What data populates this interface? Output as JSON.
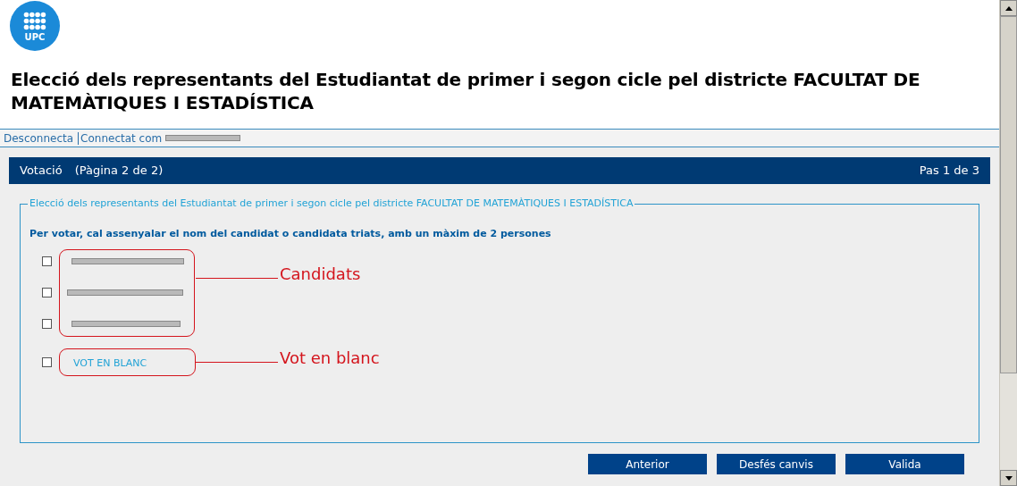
{
  "logo": {
    "text": "UPC"
  },
  "title": "Elecció dels representants del Estudiantat de primer i segon cicle pel districte FACULTAT DE MATEMÀTIQUES I ESTADÍSTICA",
  "user_bar": {
    "logout": "Desconnecta",
    "connected_as": "Connectat com",
    "user_redacted": true
  },
  "header": {
    "title": "Votació",
    "page": "(Pàgina 2 de 2)",
    "step": "Pas 1 de 3"
  },
  "fieldset": {
    "legend": "Elecció dels representants del Estudiantat de primer i segon cicle pel districte FACULTAT DE MATEMÀTIQUES I ESTADÍSTICA",
    "instruction": "Per votar, cal assenyalar el nom del candidat o candidata triats, amb un màxim de 2 persones",
    "options": [
      {
        "kind": "redacted",
        "checked": false
      },
      {
        "kind": "redacted",
        "checked": false
      },
      {
        "kind": "redacted",
        "checked": false
      },
      {
        "kind": "text",
        "label": "VOT EN BLANC",
        "checked": false
      }
    ]
  },
  "annotations": [
    {
      "label": "Candidats"
    },
    {
      "label": "Vot en blanc"
    }
  ],
  "buttons": [
    "Anterior",
    "Desfés canvis",
    "Valida"
  ]
}
